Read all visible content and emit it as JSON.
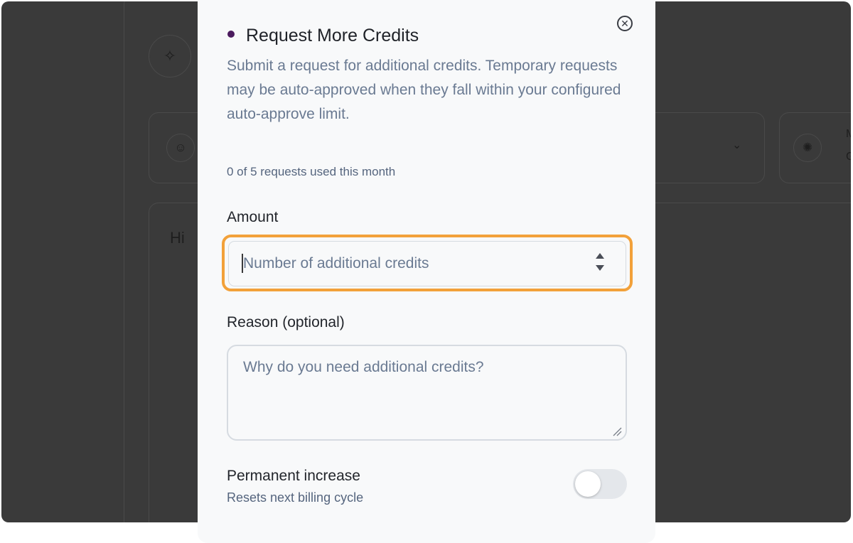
{
  "background": {
    "greeting": "Hi",
    "card2_line1": "M",
    "card2_line2": "G",
    "icons": [
      "sparkle-icon",
      "robot-icon",
      "chevron-down-icon",
      "brain-icon"
    ]
  },
  "modal": {
    "title": "Request More Credits",
    "description": "Submit a request for additional credits. Temporary requests may be auto-approved when they fall within your configured auto-approve limit.",
    "usage": "0 of 5 requests used this month",
    "amount": {
      "label": "Amount",
      "placeholder": "Number of additional credits",
      "value": ""
    },
    "reason": {
      "label": "Reason (optional)",
      "placeholder": "Why do you need additional credits?",
      "value": ""
    },
    "permanent": {
      "label": "Permanent increase",
      "hint": "Resets next billing cycle",
      "enabled": false
    }
  },
  "colors": {
    "overlay": "#3a3a3a",
    "modal_bg": "#f8f9fa",
    "focus_ring": "#f2a13a",
    "title_dot": "#4b1b5e",
    "muted_text": "#6a7a92"
  }
}
